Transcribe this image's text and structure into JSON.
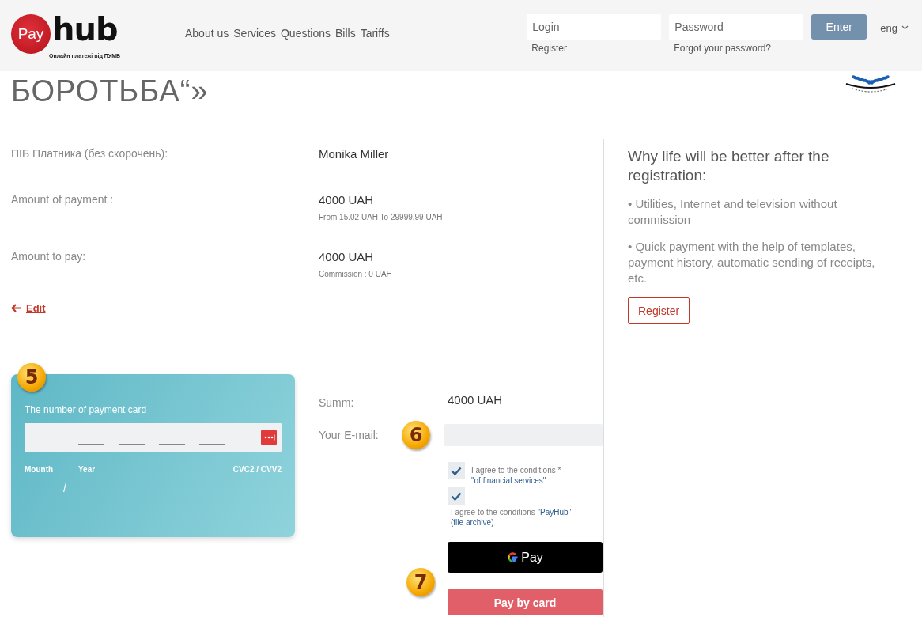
{
  "header": {
    "logo": {
      "badge": "Pay",
      "word": "hub",
      "tagline": "Онлайн платежі від ПУМБ"
    },
    "nav": [
      "About us",
      "Services",
      "Questions",
      "Bills",
      "Tariffs"
    ],
    "login": {
      "placeholder": "Login",
      "link": "Register"
    },
    "password": {
      "placeholder": "Password",
      "link": "Forgot your password?"
    },
    "enter": "Enter",
    "language": "eng"
  },
  "title": "БОРОТЬБА“»",
  "details": [
    {
      "label": "ПІБ Платника (без скорочень):",
      "value": "Monika Miller"
    },
    {
      "label": "Amount of payment :",
      "value": "4000 UAH",
      "note": "From 15.02 UAH To 29999.99 UAH"
    },
    {
      "label": "Amount to pay:",
      "value": "4000 UAH",
      "note": "Commission : 0 UAH"
    }
  ],
  "edit_link": "Edit",
  "card": {
    "marker": "5",
    "title": "The number of payment card",
    "month": "Mounth",
    "year": "Year",
    "separator": "/",
    "cvc": "CVC2 / CVV2"
  },
  "payment": {
    "sum_label": "Summ:",
    "sum": "4000 UAH",
    "email_label": "Your E-mail:",
    "email_marker": "6",
    "agreements": [
      {
        "kind": "inline",
        "checked": true,
        "text": "I agree to the conditions *",
        "link": "\"of financial services\""
      },
      {
        "kind": "below",
        "checked": true,
        "text": "I agree to the conditions",
        "link": "\"PayHub\"",
        "note": "(file archive)"
      }
    ],
    "gpay": "Pay",
    "pay_marker": "7",
    "pay_button": "Pay by card"
  },
  "aside": {
    "title": "Why life will be better after the registration:",
    "points": [
      "• Utilities, Internet and television without commission",
      "• Quick payment with the help of templates, payment history, automatic sending of receipts, etc."
    ],
    "button": "Register"
  }
}
